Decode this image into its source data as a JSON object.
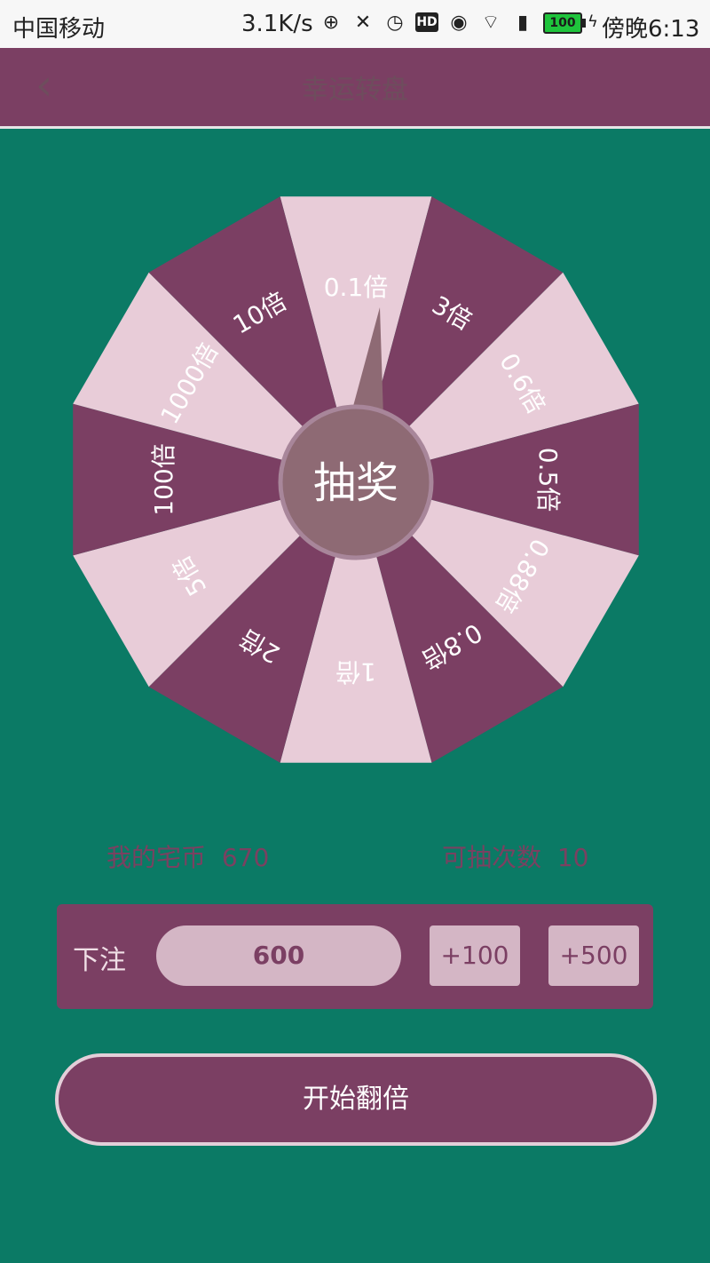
{
  "status_bar": {
    "carrier": "中国移动",
    "speed": "3.1K/s",
    "battery": "100",
    "time": "傍晚6:13"
  },
  "app_bar": {
    "title": "幸运转盘"
  },
  "wheel": {
    "center_label": "抽奖",
    "segments": [
      "0.1倍",
      "3倍",
      "0.6倍",
      "0.5倍",
      "0.88倍",
      "0.8倍",
      "1倍",
      "2倍",
      "5倍",
      "100倍",
      "1000倍",
      "10倍"
    ],
    "colors": {
      "light": "#e8ccd8",
      "dark": "#7b3f63",
      "hub": "#8e6a74",
      "hub_ring": "#a8869a"
    }
  },
  "stats": {
    "coins_label": "我的宅币",
    "coins_value": "670",
    "draws_label": "可抽次数",
    "draws_value": "10"
  },
  "bet": {
    "label": "下注",
    "amount": "600",
    "add_100": "+100",
    "add_500": "+500"
  },
  "start_button": "开始翻倍",
  "colors": {
    "background": "#0b7a65",
    "accent": "#7b3f63"
  }
}
